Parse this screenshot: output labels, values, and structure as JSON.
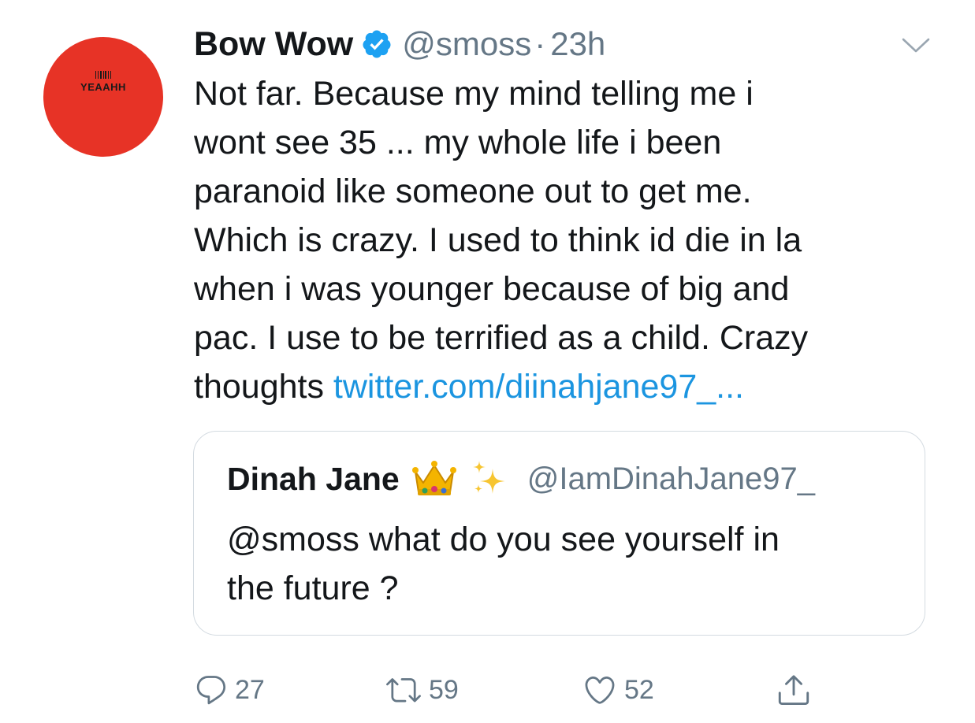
{
  "colors": {
    "avatar_bg": "#e73326",
    "verified": "#1da1f2",
    "link": "#1b95e0",
    "secondary_text": "#657786"
  },
  "tweet": {
    "avatar_text": "YEAAHH",
    "display_name": "Bow Wow",
    "handle": "@smoss",
    "separator": "·",
    "time": "23h",
    "verified_icon": "verified-badge-icon",
    "menu_icon": "chevron-down-icon",
    "body_lines": [
      "Not far. Because my mind telling me i",
      "wont see 35 ... my whole life i been",
      "paranoid like someone out to get me.",
      "Which is crazy. I used to think id die in la",
      "when i was younger because of big and",
      "pac. I use to be terrified as a child. Crazy"
    ],
    "body_last_line_text": "thoughts",
    "link_text": "twitter.com/diinahjane97_..."
  },
  "quoted_tweet": {
    "display_name": "Dinah Jane",
    "emoji_icons": [
      "crown-icon",
      "sparkles-icon"
    ],
    "handle": "@IamDinahJane97_",
    "text_lines": [
      "@smoss what do you see yourself in",
      "the future ?"
    ]
  },
  "actions": {
    "reply_count": "27",
    "retweet_count": "59",
    "like_count": "52",
    "icons": [
      "reply-icon",
      "retweet-icon",
      "like-icon",
      "share-icon"
    ]
  }
}
